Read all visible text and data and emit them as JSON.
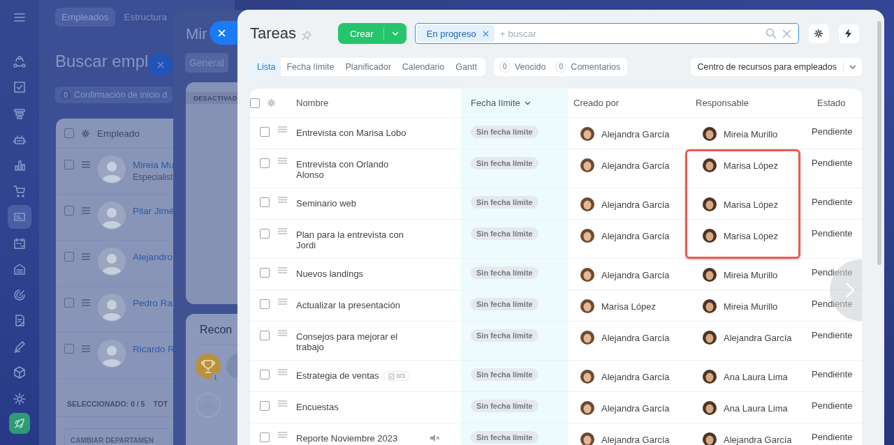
{
  "sidebar": {
    "items": [
      {
        "kind": "menu",
        "selected": false
      },
      {
        "kind": "orbit",
        "selected": false
      },
      {
        "kind": "task",
        "selected": false
      },
      {
        "kind": "funnel",
        "selected": false
      },
      {
        "kind": "robot",
        "selected": false
      },
      {
        "kind": "chart",
        "selected": false
      },
      {
        "kind": "cart",
        "selected": false
      },
      {
        "kind": "card",
        "selected": true
      },
      {
        "kind": "calendar",
        "selected": false
      },
      {
        "kind": "store",
        "selected": false
      },
      {
        "kind": "target",
        "selected": false
      },
      {
        "kind": "document",
        "selected": false
      },
      {
        "kind": "pen",
        "selected": false
      },
      {
        "kind": "box",
        "selected": false
      },
      {
        "kind": "gear",
        "selected": false
      },
      {
        "kind": "rocket",
        "selected": false
      }
    ]
  },
  "employees_page": {
    "tabs": [
      {
        "label": "Empleados",
        "selected": true
      },
      {
        "label": "Estructura",
        "selected": false
      }
    ],
    "title": "Buscar empl",
    "filter": {
      "count": "0",
      "label": "Confirmación de inicio d"
    },
    "table": {
      "header": "Empleado",
      "all_checked": false,
      "rows": [
        {
          "name": "Mireia Mu",
          "subtitle": "Especialist",
          "checked": false
        },
        {
          "name": "Pilar Jimé",
          "checked": false
        },
        {
          "name": "Alejandro",
          "checked": false
        },
        {
          "name": "Pedro Ra",
          "checked": false
        },
        {
          "name": "Ricardo R",
          "checked": false
        }
      ]
    },
    "footer": {
      "selected": "SELECCIONADO: **0 / 5**",
      "total": "TOT"
    },
    "button": "CAMBIAR DEPARTAMEN"
  },
  "profile_panel": {
    "title": "Mir",
    "tab": "General",
    "status_badge": "DESACTIVAD",
    "section_title": "Recon",
    "award_count": "1"
  },
  "tasks": {
    "title": "Tareas",
    "create_button": "Crear",
    "search": {
      "chip": "En progreso",
      "placeholder": "+ buscar"
    },
    "views": [
      {
        "label": "Lista",
        "selected": true
      },
      {
        "label": "Fecha límite",
        "selected": false
      },
      {
        "label": "Planificador",
        "selected": false
      },
      {
        "label": "Calendario",
        "selected": false
      },
      {
        "label": "Gantt",
        "selected": false
      }
    ],
    "counters": [
      {
        "count": "0",
        "label": "Vencido"
      },
      {
        "count": "0",
        "label": "Comentarios"
      }
    ],
    "project": "Centro de recursos para empleados",
    "all_checked": false,
    "columns": [
      {
        "label": "Nombre",
        "sorted": false
      },
      {
        "label": "Fecha límite",
        "sorted": true
      },
      {
        "label": "Creado por",
        "sorted": false
      },
      {
        "label": "Responsable",
        "sorted": false
      },
      {
        "label": "Estado",
        "sorted": false
      }
    ],
    "rows": [
      {
        "name": "Entrevista con Marisa Lobo",
        "checked": false,
        "muted": false,
        "deadline": "Sin fecha límite",
        "created_by": "Alejandra García",
        "responsible": "Mireia Murillo",
        "status": "Pendiente",
        "highlighted": false
      },
      {
        "name": "Entrevista con Orlando Alonso",
        "checked": false,
        "muted": false,
        "deadline": "Sin fecha límite",
        "created_by": "Alejandra García",
        "responsible": "Marisa López",
        "status": "Pendiente",
        "highlighted": true
      },
      {
        "name": "Seminario web",
        "checked": false,
        "muted": false,
        "deadline": "Sin fecha límite",
        "created_by": "Alejandra García",
        "responsible": "Marisa López",
        "status": "Pendiente",
        "highlighted": true
      },
      {
        "name": "Plan para la entrevista con Jordi",
        "checked": false,
        "muted": false,
        "deadline": "Sin fecha límite",
        "created_by": "Alejandra García",
        "responsible": "Marisa López",
        "status": "Pendiente",
        "highlighted": true
      },
      {
        "name": "Nuevos landings",
        "checked": false,
        "muted": false,
        "deadline": "Sin fecha límite",
        "created_by": "Alejandra García",
        "responsible": "Mireia Murillo",
        "status": "Pendiente",
        "highlighted": false
      },
      {
        "name": "Actualizar la presentación",
        "checked": false,
        "muted": false,
        "deadline": "Sin fecha límite",
        "created_by": "Marisa López",
        "responsible": "Mireia Murillo",
        "status": "Pendiente",
        "highlighted": false
      },
      {
        "name": "Consejos para mejorar el trabajo",
        "checked": false,
        "muted": false,
        "deadline": "Sin fecha límite",
        "created_by": "Alejandra García",
        "responsible": "Alejandra García",
        "status": "Pendiente",
        "highlighted": false
      },
      {
        "name": "Estrategia de ventas",
        "checklist": "0/3",
        "checked": false,
        "muted": false,
        "deadline": "Sin fecha límite",
        "created_by": "Alejandra García",
        "responsible": "Ana Laura Lima",
        "status": "Pendiente",
        "highlighted": false
      },
      {
        "name": "Encuestas",
        "checked": false,
        "muted": false,
        "deadline": "Sin fecha límite",
        "created_by": "Alejandra García",
        "responsible": "Ana Laura Lima",
        "status": "Pendiente",
        "highlighted": false
      },
      {
        "name": "Reporte Noviembre 2023",
        "checked": false,
        "muted": true,
        "deadline": "Sin fecha límite",
        "created_by": "Alejandra García",
        "responsible": "Alejandra García",
        "status": "Pendiente",
        "highlighted": false
      }
    ]
  }
}
